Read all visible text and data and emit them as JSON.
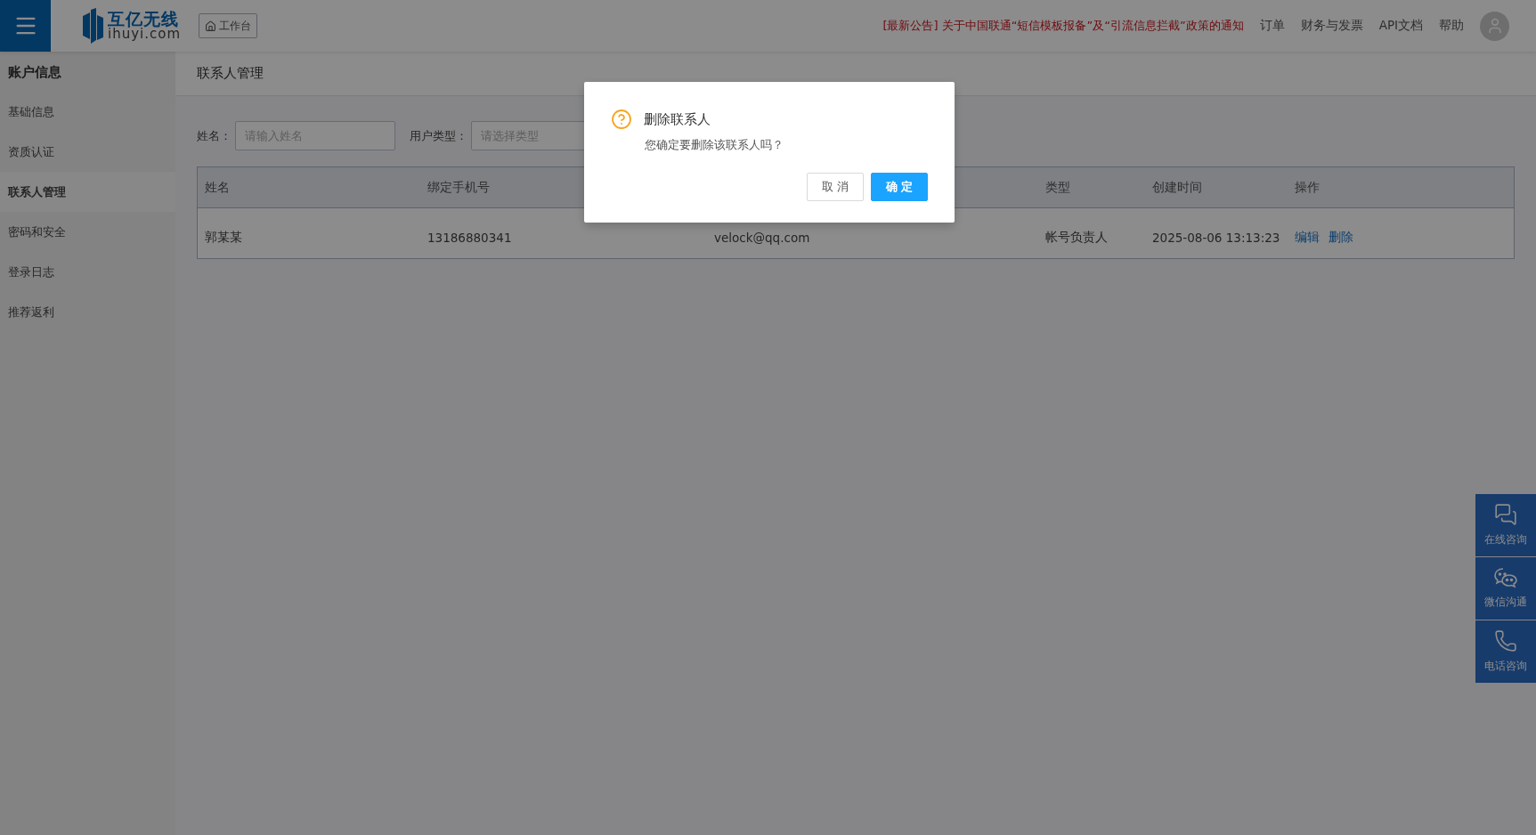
{
  "header": {
    "logo": {
      "name": "互亿无线",
      "domain": "ihuyi.com"
    },
    "workbench_label": "工作台",
    "notice": "[最新公告] 关于中国联通“短信模板报备”及“引流信息拦截”政策的通知",
    "nav": [
      "订单",
      "财务与发票",
      "API文档",
      "帮助"
    ]
  },
  "sidebar": {
    "title": "账户信息",
    "items": [
      {
        "label": "基础信息",
        "selected": false
      },
      {
        "label": "资质认证",
        "selected": false
      },
      {
        "label": "联系人管理",
        "selected": true
      },
      {
        "label": "密码和安全",
        "selected": false
      },
      {
        "label": "登录日志",
        "selected": false
      },
      {
        "label": "推荐返利",
        "selected": false
      }
    ]
  },
  "page_title": "联系人管理",
  "filters": [
    {
      "kind": "input",
      "label": "姓名：",
      "placeholder": "请输入姓名"
    },
    {
      "kind": "select",
      "label": "用户类型：",
      "placeholder": "请选择类型"
    }
  ],
  "table": {
    "columns": [
      {
        "kind": "text",
        "label": "姓名"
      },
      {
        "kind": "text",
        "label": "绑定手机号"
      },
      {
        "kind": "covered"
      },
      {
        "kind": "text",
        "label": "类型"
      },
      {
        "kind": "text",
        "label": "创建时间"
      },
      {
        "kind": "text",
        "label": "操作"
      }
    ],
    "rows": [
      {
        "cells": [
          "郭某某",
          "13186880341",
          "velock@qq.com",
          "帐号负责人",
          "2025-08-06 13:13:23"
        ],
        "actions": [
          "编辑",
          "删除"
        ]
      }
    ]
  },
  "dialog": {
    "title": "删除联系人",
    "message": "您确定要删除该联系人吗？",
    "buttons": [
      {
        "kind": "default",
        "label": "取 消"
      },
      {
        "kind": "primary",
        "label": "确 定"
      }
    ]
  },
  "float_buttons": [
    {
      "kind": "chat",
      "label": "在线咨询"
    },
    {
      "kind": "wechat",
      "label": "微信沟通"
    },
    {
      "kind": "phone",
      "label": "电话咨询"
    }
  ]
}
